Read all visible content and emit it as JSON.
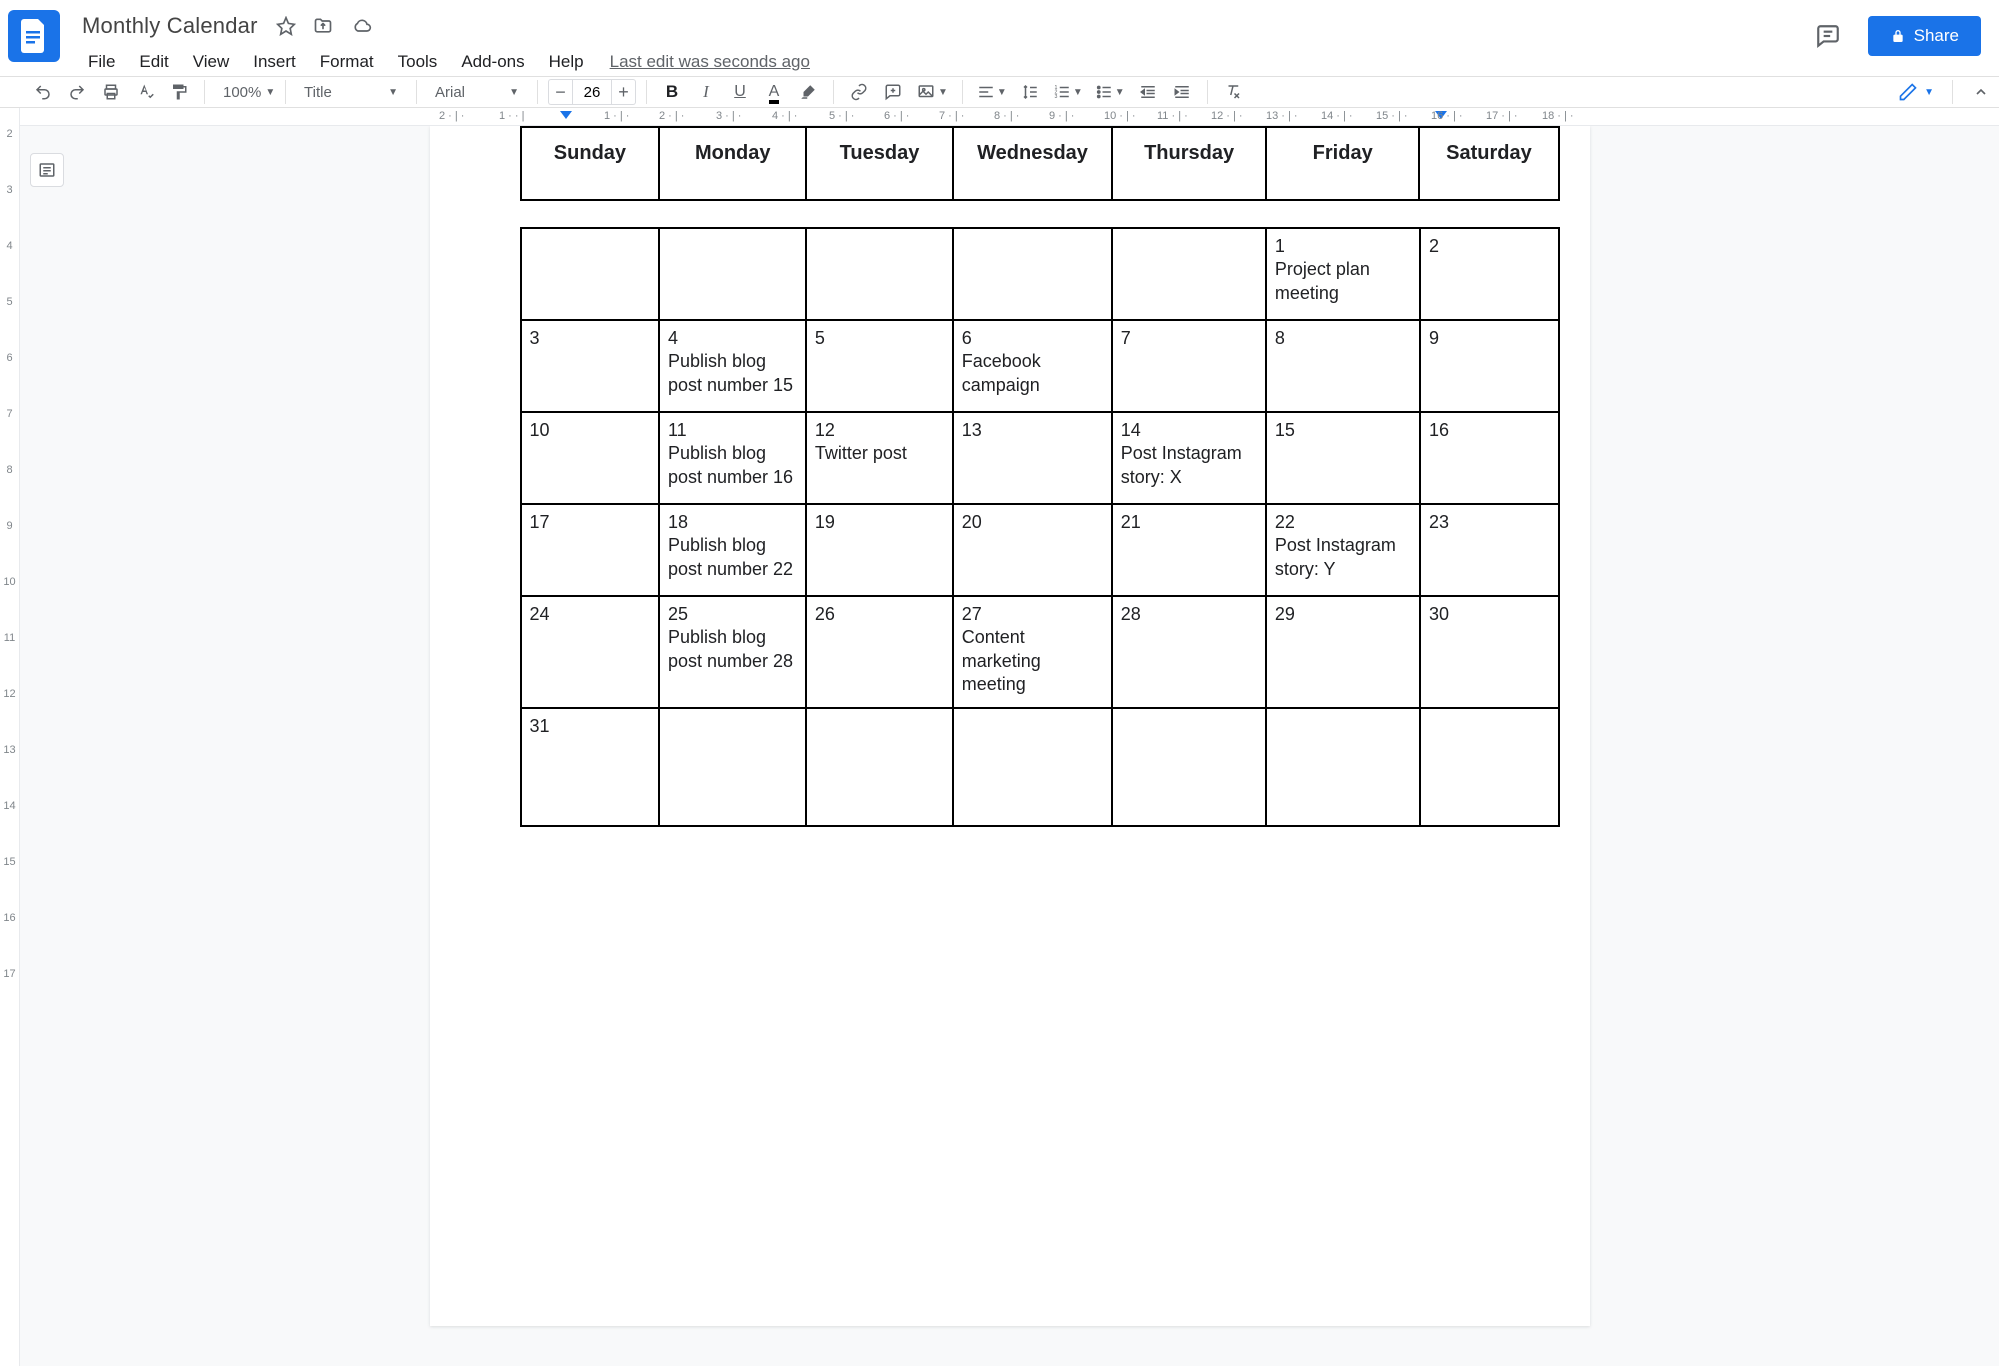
{
  "doc": {
    "title": "Monthly Calendar",
    "last_edit": "Last edit was seconds ago"
  },
  "menubar": [
    "File",
    "Edit",
    "View",
    "Insert",
    "Format",
    "Tools",
    "Add-ons",
    "Help"
  ],
  "share": {
    "label": "Share"
  },
  "toolbar": {
    "zoom": "100%",
    "style": "Title",
    "font": "Arial",
    "font_size": "26"
  },
  "hruler": {
    "labels": [
      "2",
      "1",
      "1",
      "2",
      "3",
      "4",
      "5",
      "6",
      "7",
      "8",
      "9",
      "10",
      "11",
      "12",
      "13",
      "14",
      "15",
      "16",
      "17",
      "18"
    ]
  },
  "vruler": {
    "labels": [
      "2",
      "3",
      "4",
      "5",
      "6",
      "7",
      "8",
      "9",
      "10",
      "11",
      "12",
      "13",
      "14",
      "15",
      "16",
      "17"
    ]
  },
  "calendar": {
    "days": [
      "Sunday",
      "Monday",
      "Tuesday",
      "Wednesday",
      "Thursday",
      "Friday",
      "Saturday"
    ],
    "rows": [
      [
        {
          "num": "",
          "text": ""
        },
        {
          "num": "",
          "text": ""
        },
        {
          "num": "",
          "text": ""
        },
        {
          "num": "",
          "text": ""
        },
        {
          "num": "",
          "text": ""
        },
        {
          "num": "1",
          "text": "Project plan meeting"
        },
        {
          "num": "2",
          "text": ""
        }
      ],
      [
        {
          "num": "3",
          "text": ""
        },
        {
          "num": "4",
          "text": "Publish blog post number 15"
        },
        {
          "num": "5",
          "text": ""
        },
        {
          "num": "6",
          "text": "Facebook campaign"
        },
        {
          "num": "7",
          "text": ""
        },
        {
          "num": "8",
          "text": ""
        },
        {
          "num": "9",
          "text": ""
        }
      ],
      [
        {
          "num": "10",
          "text": ""
        },
        {
          "num": "11",
          "text": "Publish blog post number 16"
        },
        {
          "num": "12",
          "text": "Twitter post"
        },
        {
          "num": "13",
          "text": ""
        },
        {
          "num": "14",
          "text": "Post Instagram story: X"
        },
        {
          "num": "15",
          "text": ""
        },
        {
          "num": "16",
          "text": ""
        }
      ],
      [
        {
          "num": "17",
          "text": ""
        },
        {
          "num": "18",
          "text": "Publish blog post number 22"
        },
        {
          "num": "19",
          "text": ""
        },
        {
          "num": "20",
          "text": ""
        },
        {
          "num": "21",
          "text": ""
        },
        {
          "num": "22",
          "text": "Post Instagram story: Y"
        },
        {
          "num": "23",
          "text": ""
        }
      ],
      [
        {
          "num": "24",
          "text": ""
        },
        {
          "num": "25",
          "text": "Publish blog post number 28"
        },
        {
          "num": "26",
          "text": ""
        },
        {
          "num": "27",
          "text": "Content marketing meeting"
        },
        {
          "num": "28",
          "text": ""
        },
        {
          "num": "29",
          "text": ""
        },
        {
          "num": "30",
          "text": ""
        }
      ],
      [
        {
          "num": "31",
          "text": ""
        },
        {
          "num": "",
          "text": ""
        },
        {
          "num": "",
          "text": ""
        },
        {
          "num": "",
          "text": ""
        },
        {
          "num": "",
          "text": ""
        },
        {
          "num": "",
          "text": ""
        },
        {
          "num": "",
          "text": ""
        }
      ]
    ]
  }
}
